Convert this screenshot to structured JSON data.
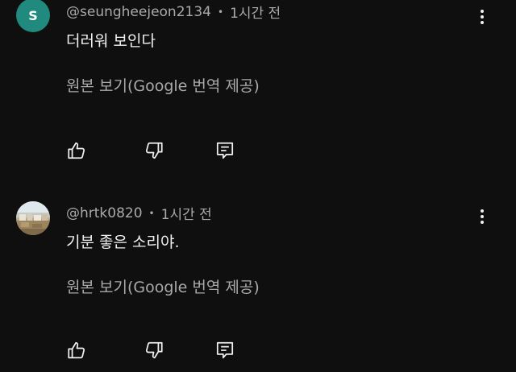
{
  "comments": [
    {
      "avatar_letter": "S",
      "avatar_color": "#1f8a7d",
      "author": "@seungheejeon2134",
      "separator": "•",
      "time": "1시간 전",
      "text": "더러워 보인다",
      "translate_label": "원본 보기(Google 번역 제공)",
      "icons": [
        "like-icon",
        "dislike-icon",
        "reply-icon",
        "more-vert-icon"
      ]
    },
    {
      "avatar_type": "photo",
      "author": "@hrtk0820",
      "separator": "•",
      "time": "1시간 전",
      "text": "기분 좋은 소리야.",
      "translate_label": "원본 보기(Google 번역 제공)",
      "icons": [
        "like-icon",
        "dislike-icon",
        "reply-icon",
        "more-vert-icon"
      ]
    }
  ],
  "colors": {
    "background": "#0f0f0f",
    "primary_text": "#f1f1f1",
    "secondary_text": "#aaaaaa"
  }
}
